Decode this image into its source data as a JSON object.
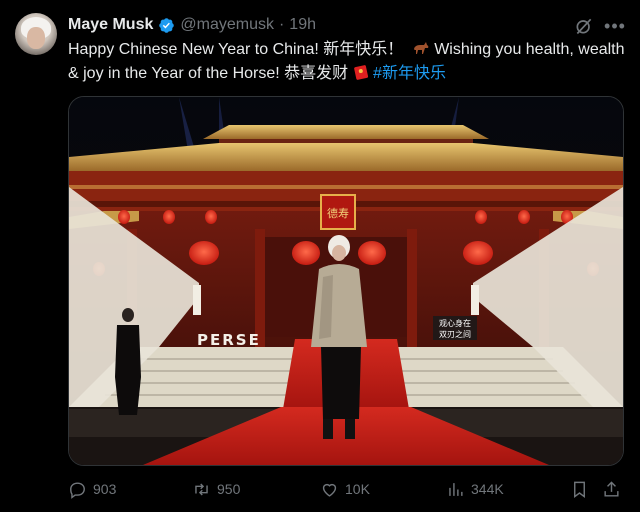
{
  "author": {
    "name": "Maye Musk",
    "handle": "@mayemusk",
    "separator": "·",
    "time": "19h"
  },
  "tweet": {
    "text_main": "Happy Chinese New Year to China! 新年快乐！",
    "text_mid": " Wishing you health, wealth & joy in the Year of the Horse! 恭喜发财 ",
    "hashtag": "#新年快乐"
  },
  "media": {
    "plaque_text": "德寿",
    "sign_left": "PERSE",
    "sign_right_line1": "观心身在",
    "sign_right_line2": "双刃之间"
  },
  "actions": {
    "replies": "903",
    "reposts": "950",
    "likes": "10K",
    "views": "344K"
  },
  "colors": {
    "background": "#000000",
    "text": "#e7e9ea",
    "secondary": "#71767b",
    "accent": "#1d9bf0"
  },
  "icons": [
    "verified-badge-icon",
    "grok-icon",
    "more-icon",
    "horse-emoji-icon",
    "red-envelope-emoji-icon",
    "reply-icon",
    "repost-icon",
    "like-icon",
    "views-icon",
    "bookmark-icon",
    "share-icon"
  ]
}
